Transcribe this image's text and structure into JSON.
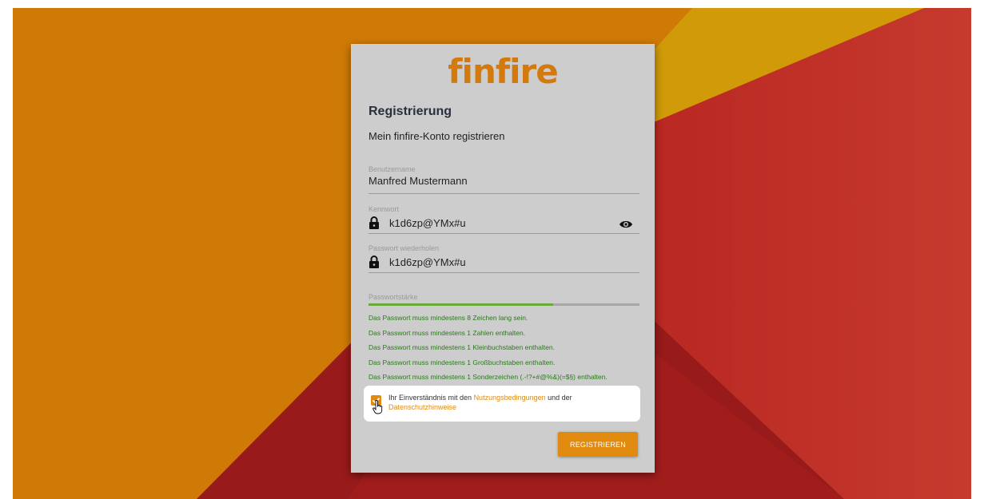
{
  "brand": {
    "logo_text": "finfire",
    "accent_color": "#e08a10",
    "logo_color": "#d4790b"
  },
  "form": {
    "title": "Registrierung",
    "subtitle": "Mein finfire-Konto registrieren",
    "username": {
      "label": "Benutzername",
      "value": "Manfred Mustermann"
    },
    "password": {
      "label": "Kennwort",
      "value": "k1d6zp@YMx#u",
      "icon": "lock-icon",
      "toggle_icon": "eye-icon"
    },
    "password_repeat": {
      "label": "Passwort wiederholen",
      "value": "k1d6zp@YMx#u",
      "icon": "lock-icon"
    },
    "strength": {
      "label": "Passwortstärke",
      "level_percent": 68,
      "color": "#6aaa36"
    },
    "rules": [
      "Das Passwort muss mindestens 8 Zeichen lang sein.",
      "Das Passwort muss mindestens 1 Zahlen enthalten.",
      "Das Passwort muss mindestens 1 Kleinbuchstaben enthalten.",
      "Das Passwort muss mindestens 1 Großbuchstaben enthalten.",
      "Das Passwort muss mindestens 1 Sonderzeichen (.-!?+#@%&)(=$§) enthalten."
    ],
    "rule_color": "#2a7a1a",
    "consent": {
      "checked": true,
      "text_before": "Ihr Einverständnis mit den ",
      "terms_link": "Nutzungsbedingungen",
      "text_middle": " und der ",
      "privacy_link": "Datenschutzhinweise"
    },
    "submit_label": "REGISTRIEREN"
  }
}
